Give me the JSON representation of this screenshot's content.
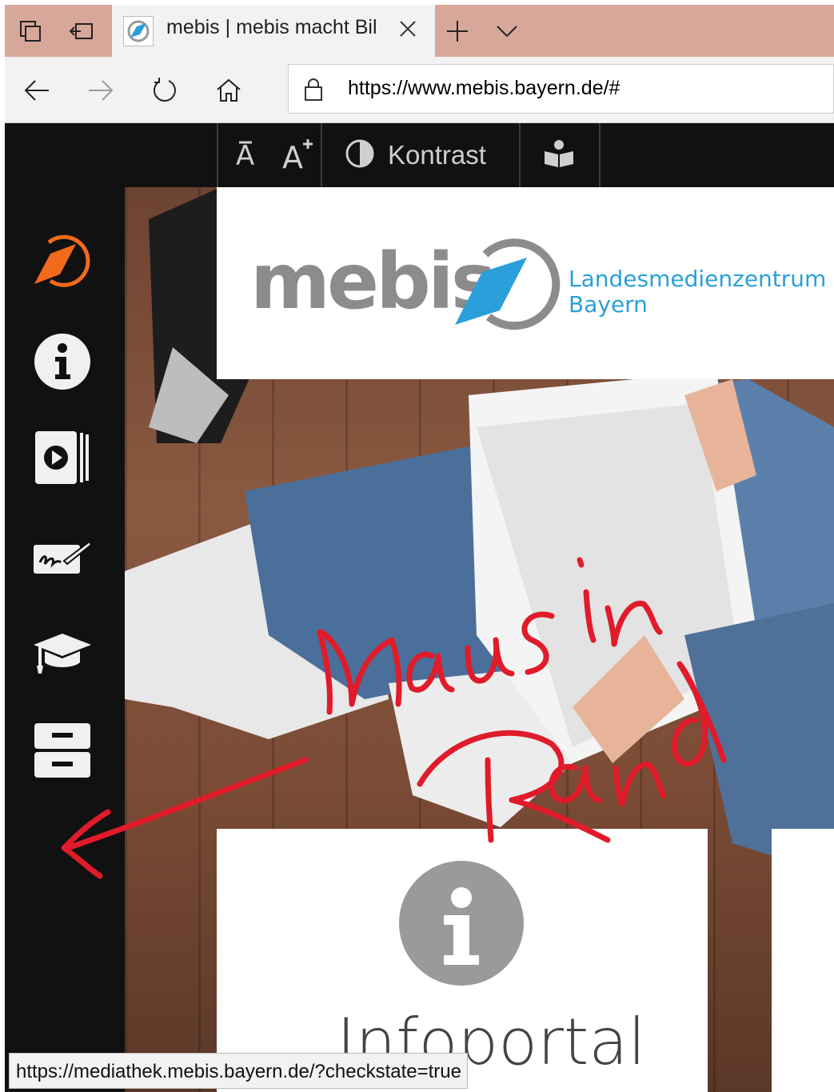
{
  "browser": {
    "tab_title": "mebis | mebis macht Bil",
    "address": "https://www.mebis.bayern.de/#",
    "status_url": "https://mediathek.mebis.bayern.de/?checkstate=true",
    "tab_icons": [
      "tab-overview-icon",
      "set-aside-tabs-icon",
      "new-tab-icon",
      "tab-list-chevron-icon"
    ],
    "nav_icons": [
      "back-arrow-icon",
      "forward-arrow-icon",
      "refresh-icon",
      "home-icon",
      "lock-icon"
    ]
  },
  "toolbar": {
    "kontrast_label": "Kontrast",
    "icons": [
      "font-smaller-icon",
      "font-larger-icon",
      "contrast-icon",
      "reader-icon"
    ]
  },
  "sidebar": {
    "items": [
      "mebis-compass-icon",
      "info-icon",
      "mediathek-video-icon",
      "signature-icon",
      "graduation-cap-icon",
      "archive-icon"
    ]
  },
  "logo": {
    "word": "mebis",
    "sub_line1": "Landesmedienzentrum",
    "sub_line2": "Bayern",
    "colors": {
      "gray": "#8c8c8c",
      "blue": "#2b9fd9"
    }
  },
  "cards": {
    "info_title": "Infoportal"
  },
  "annotation": {
    "line1": "Maus in",
    "line2": "Rand",
    "color": "#e01b2a"
  },
  "colors": {
    "tabbar": "#d7a79a",
    "chrome": "#f2f2f2",
    "page_dark": "#111111",
    "accent_orange": "#f26a1b"
  }
}
